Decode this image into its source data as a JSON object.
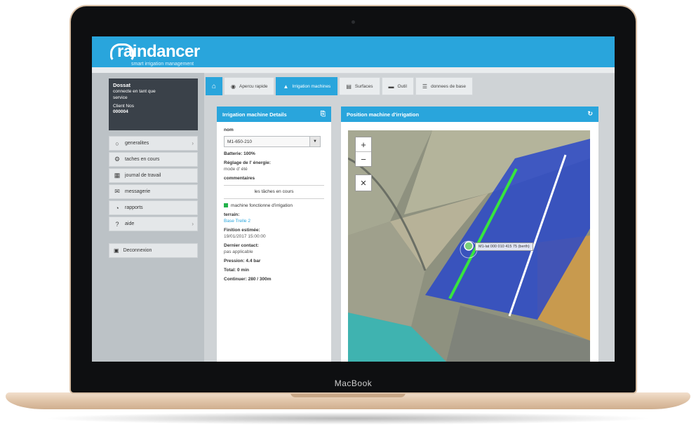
{
  "laptop": {
    "brand": "MacBook"
  },
  "app": {
    "logo_text": "raindancer",
    "logo_tagline": "smart irrigation management"
  },
  "user": {
    "name": "Dossat",
    "role_line1": "connecte en tant que",
    "role_line2": "service",
    "client_label": "Client Nos",
    "client_number": "000004"
  },
  "menu": {
    "items": [
      {
        "label": "generalites",
        "icon": "circle-icon"
      },
      {
        "label": "taches en cours",
        "icon": "gear-icon"
      },
      {
        "label": "journal de travail",
        "icon": "calendar-icon"
      },
      {
        "label": "messagerie",
        "icon": "envelope-icon"
      },
      {
        "label": "rapports",
        "icon": "chart-icon"
      },
      {
        "label": "aide",
        "icon": "question-icon"
      }
    ],
    "logout": "Deconnexion"
  },
  "tabs": [
    {
      "label": "Apercu rapide"
    },
    {
      "label": "Irrigation machines"
    },
    {
      "label": "Surfaces"
    },
    {
      "label": "Outil"
    },
    {
      "label": "donnees de base"
    }
  ],
  "details": {
    "title": "Irrigation machine Details",
    "nom_label": "nom",
    "selected_machine": "M1-650-210",
    "batterie": "Batterie: 100%",
    "reglage_label": "Réglage de l' énergie:",
    "reglage_value": "mode d' été",
    "commentaires_label": "commentaires",
    "taches_label": "les tâches en cours",
    "task_item": "machine fonctionne d'irrigation",
    "terrain_label": "terrain:",
    "terrain_value": "Base Trelle 2",
    "fin_label": "Finition estimée:",
    "fin_value": "19/01/2017 15:00:00",
    "contact_label": "Dernier contact:",
    "contact_value": "pas applicable",
    "pression": "Pression: 4.4 bar",
    "total": "Total: 0 min",
    "continuer": "Continuer: 280 / 300m"
  },
  "mapPanel": {
    "title": "Position machine d'irrigation",
    "tooltip": "M1-lat 000 010 415 75 (berth)",
    "zoom_in": "+",
    "zoom_out": "−"
  },
  "colors": {
    "accent": "#29a5dc",
    "field_overlay": "#2a48c8",
    "irrigation_line": "#37e53e"
  }
}
